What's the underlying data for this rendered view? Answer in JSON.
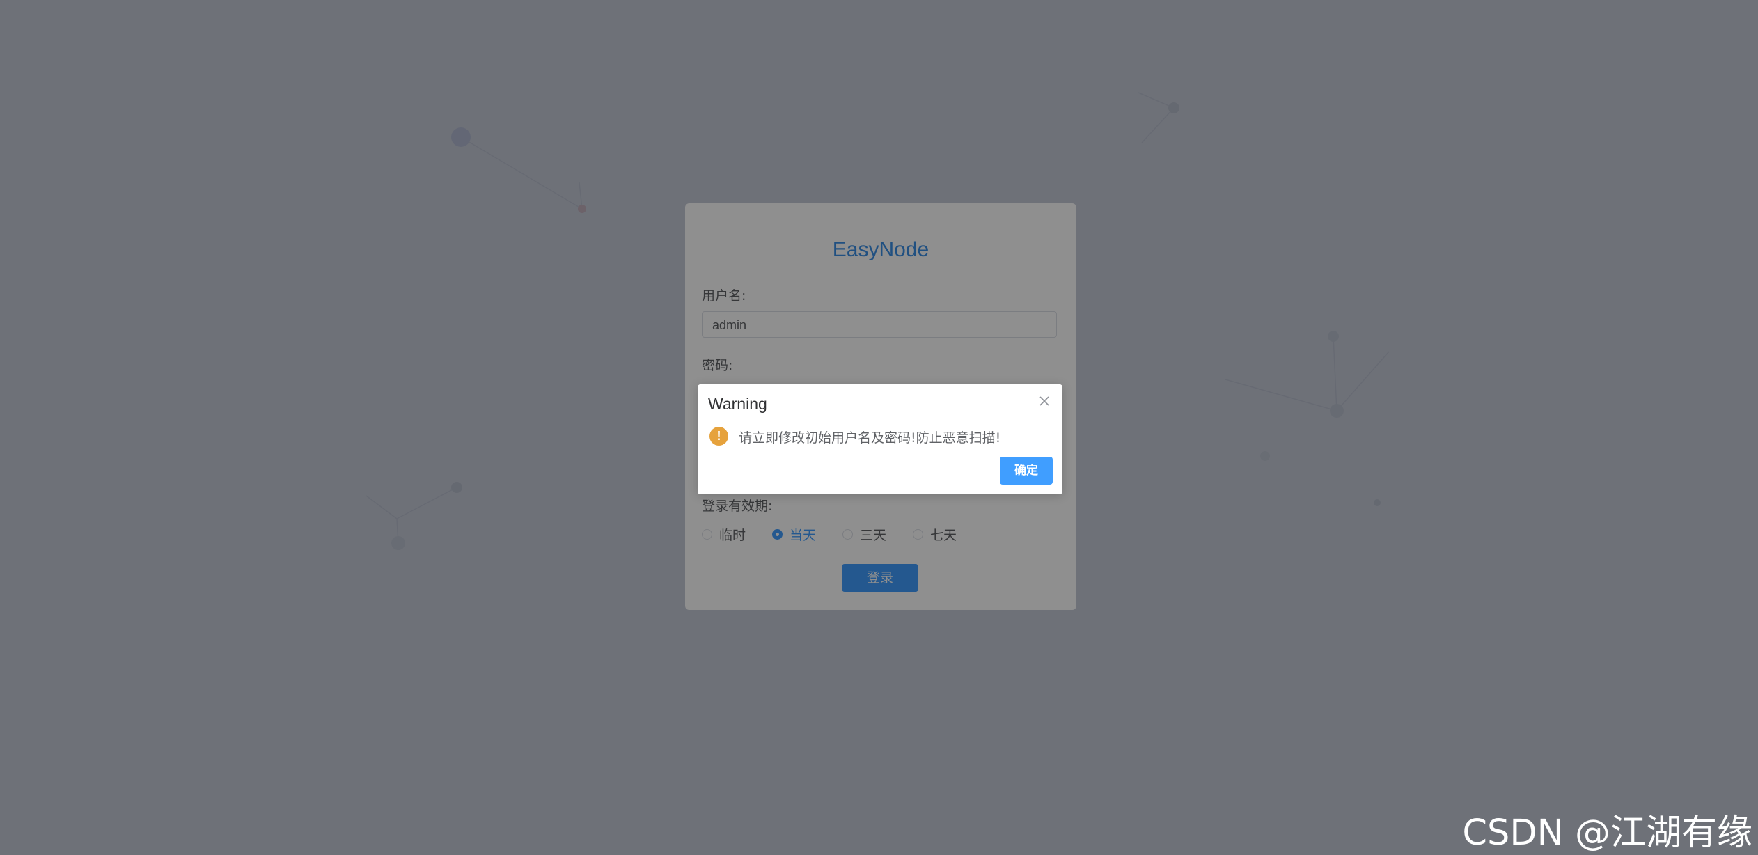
{
  "login": {
    "title": "EasyNode",
    "username_label": "用户名:",
    "username_value": "admin",
    "password_label": "密码:",
    "expire_label": "登录有效期:",
    "expire_options": [
      "临时",
      "当天",
      "三天",
      "七天"
    ],
    "expire_selected": "当天",
    "submit_label": "登录"
  },
  "dialog": {
    "title": "Warning",
    "message": "请立即修改初始用户名及密码!防止恶意扫描!",
    "confirm_label": "确定",
    "icon": "warning-icon",
    "close_icon": "close-icon"
  },
  "watermark": "CSDN @江湖有缘",
  "colors": {
    "accent": "#409eff",
    "warning": "#e6a23c",
    "overlay": "#52565e"
  }
}
